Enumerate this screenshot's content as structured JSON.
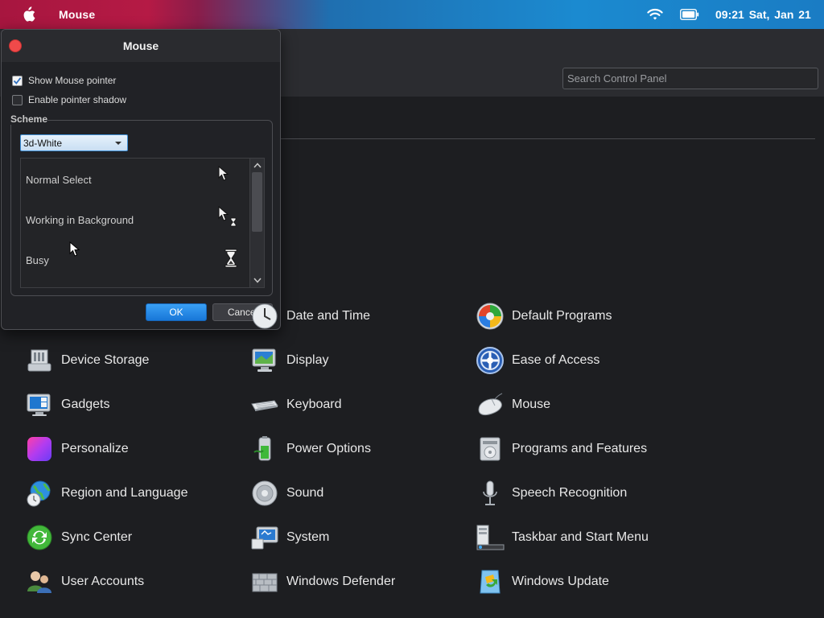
{
  "menubar": {
    "app_name": "Mouse",
    "clock": "09:21  Sat, Jan 21",
    "icons": [
      "apple-icon",
      "wifi-icon",
      "battery-icon"
    ]
  },
  "control_panel": {
    "search_placeholder": "Search Control Panel",
    "items": [
      {
        "label": "Date and Time",
        "icon": "clock-icon"
      },
      {
        "label": "Default Programs",
        "icon": "windows-logo-icon"
      },
      {
        "label": "Device Storage",
        "icon": "storage-icon"
      },
      {
        "label": "Display",
        "icon": "monitor-icon"
      },
      {
        "label": "Ease of Access",
        "icon": "accessibility-icon"
      },
      {
        "label": "Gadgets",
        "icon": "gadgets-icon"
      },
      {
        "label": "Keyboard",
        "icon": "keyboard-icon"
      },
      {
        "label": "Mouse",
        "icon": "mouse-icon"
      },
      {
        "label": "Personalize",
        "icon": "personalize-icon"
      },
      {
        "label": "Power Options",
        "icon": "battery-power-icon"
      },
      {
        "label": "Programs and Features",
        "icon": "programs-icon"
      },
      {
        "label": "Region and Language",
        "icon": "globe-icon"
      },
      {
        "label": "Sound",
        "icon": "speaker-icon"
      },
      {
        "label": "Speech Recognition",
        "icon": "microphone-icon"
      },
      {
        "label": "Sync Center",
        "icon": "sync-icon"
      },
      {
        "label": "System",
        "icon": "computer-icon"
      },
      {
        "label": "Taskbar and Start Menu",
        "icon": "taskbar-icon"
      },
      {
        "label": "User Accounts",
        "icon": "users-icon"
      },
      {
        "label": "Windows Defender",
        "icon": "defender-wall-icon"
      },
      {
        "label": "Windows Update",
        "icon": "update-icon"
      }
    ]
  },
  "dialog": {
    "title": "Mouse",
    "show_pointer_label": "Show Mouse pointer",
    "show_pointer_checked": true,
    "shadow_label": "Enable pointer shadow",
    "shadow_checked": false,
    "scheme_legend": "Scheme",
    "scheme_value": "3d-White",
    "cursors": [
      {
        "label": "Normal Select",
        "icon": "arrow-cursor-icon"
      },
      {
        "label": "Working in Background",
        "icon": "arrow-hourglass-cursor-icon"
      },
      {
        "label": "Busy",
        "icon": "hourglass-cursor-icon"
      }
    ],
    "ok_label": "OK",
    "cancel_label": "Cancel"
  },
  "colors": {
    "accent": "#1877d8",
    "close_button": "#f04a4a",
    "background": "#1d1e21"
  }
}
